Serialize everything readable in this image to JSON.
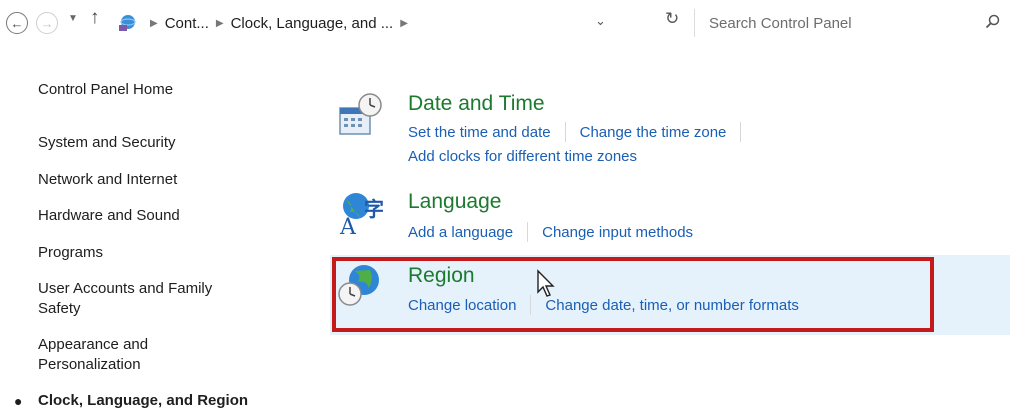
{
  "toolbar": {
    "breadcrumb": [
      "Cont...",
      "Clock, Language, and ..."
    ],
    "search_placeholder": "Search Control Panel"
  },
  "leftnav": {
    "home": "Control Panel Home",
    "items": [
      {
        "label": "System and Security"
      },
      {
        "label": "Network and Internet"
      },
      {
        "label": "Hardware and Sound"
      },
      {
        "label": "Programs"
      },
      {
        "label": "User Accounts and Family Safety",
        "lines": [
          "User Accounts and Family",
          "Safety"
        ]
      },
      {
        "label": "Appearance and Personalization",
        "lines": [
          "Appearance and",
          "Personalization"
        ]
      },
      {
        "label": "Clock, Language, and Region",
        "current": true
      }
    ]
  },
  "categories": [
    {
      "title": "Date and Time",
      "icon": "date-time-icon",
      "links": [
        "Set the time and date",
        "Change the time zone",
        "Add clocks for different time zones"
      ]
    },
    {
      "title": "Language",
      "icon": "language-icon",
      "links": [
        "Add a language",
        "Change input methods"
      ]
    },
    {
      "title": "Region",
      "icon": "region-globe-icon",
      "links": [
        "Change location",
        "Change date, time, or number formats"
      ],
      "highlighted": true
    }
  ],
  "colors": {
    "category_title": "#1c7a2f",
    "link": "#1a5fb4",
    "highlight_bg": "#e5f1fb",
    "annotation_outline": "#c41a1a"
  }
}
